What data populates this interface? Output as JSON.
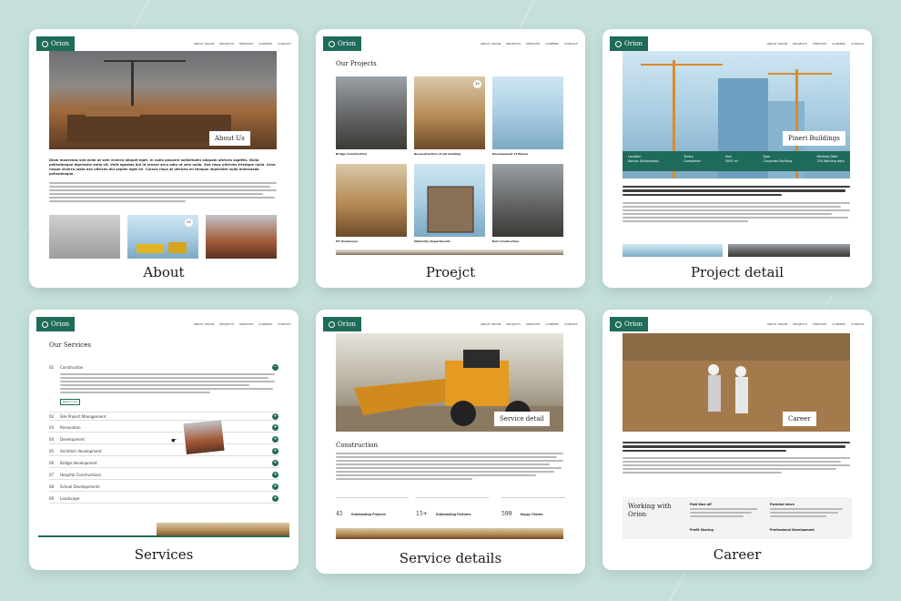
{
  "brand": {
    "name": "Orion",
    "accent": "#1f6b5a",
    "background": "#c5e0dc"
  },
  "nav": [
    "ABOUT ORION",
    "PROJECTS",
    "SERVICES",
    "CAREERS",
    "CONTACT"
  ],
  "cards": {
    "about": {
      "caption": "About",
      "hero_title": "About Us",
      "lead_text": "Diam maecenas sed enim ut sem viverra aliquet eget. In nulla posuere sollicitudin aliquam ultrices sagittis. Nulla pellentesque dignissim enim sit. Velit egestas dui id ornare arcu odio ut sem nulla. Sed risus ultricies tristique nulla. Urna neque viverra justo nec ultrices dui sapien eget mi. Cursus risus at ultrices mi tempus imperdiet nulla malesuada pellentesque.",
      "gallery_badge": "21"
    },
    "project": {
      "caption": "Proejct",
      "heading": "Our Projects",
      "badge": "25",
      "items": [
        "Bridge Construction",
        "Reconstruction of old building",
        "Development of Planes",
        "HT Townhouse",
        "Maternity Departments",
        "Bell Construction"
      ]
    },
    "project_detail": {
      "caption": "Project detail",
      "title": "Pineri Buildings",
      "facts": [
        {
          "label": "Location",
          "value": "Kanlaa (Antistoleos)"
        },
        {
          "label": "Status",
          "value": "Completed"
        },
        {
          "label": "Size",
          "value": "3000 m²"
        },
        {
          "label": "Type",
          "value": "Corporate Building"
        },
        {
          "label": "Working Date",
          "value": "250 Working days"
        }
      ]
    },
    "services": {
      "caption": "Services",
      "heading": "Our Services",
      "first": {
        "num": "01",
        "label": "Construction",
        "button": "Read more"
      },
      "items": [
        {
          "num": "02",
          "label": "Site Project Management"
        },
        {
          "num": "03",
          "label": "Renovation"
        },
        {
          "num": "04",
          "label": "Development"
        },
        {
          "num": "05",
          "label": "Architect development"
        },
        {
          "num": "06",
          "label": "Bridge development"
        },
        {
          "num": "07",
          "label": "Hospital Constructions"
        },
        {
          "num": "08",
          "label": "School Developments"
        },
        {
          "num": "09",
          "label": "Landscape"
        }
      ]
    },
    "service_details": {
      "caption": "Service details",
      "hero_title": "Service detail",
      "section_title": "Construction",
      "stats": [
        {
          "value": "45",
          "label": "Outstanding Projects"
        },
        {
          "value": "15+",
          "label": "Outstanding Partners"
        },
        {
          "value": "599",
          "label": "Happy Clients"
        }
      ]
    },
    "career": {
      "caption": "Career",
      "hero_title": "Career",
      "box_title": "Working with Orion",
      "benefits": [
        "Paid time off",
        "Parental leave",
        "Profit Sharing",
        "Professional Development"
      ]
    }
  }
}
